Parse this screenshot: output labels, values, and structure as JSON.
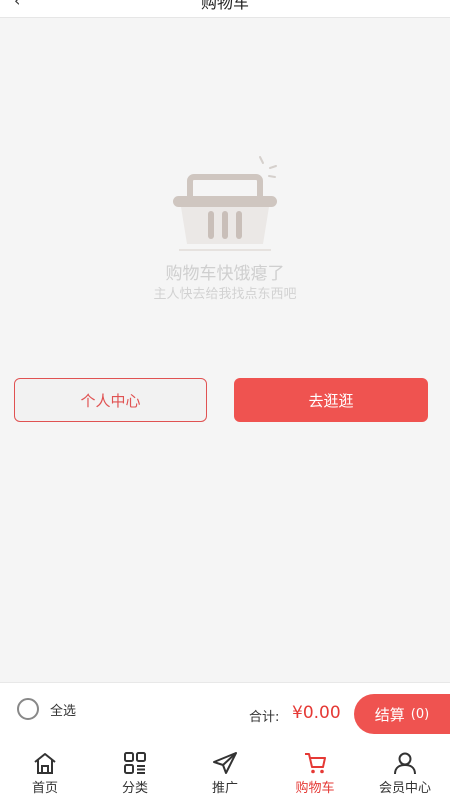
{
  "header": {
    "back_glyph": "‹",
    "title": "购物车"
  },
  "empty": {
    "icon": "empty-basket-icon",
    "title": "购物车快饿瘪了",
    "subtitle": "主人快去给我找点东西吧"
  },
  "actions": {
    "personal_center": "个人中心",
    "go_shopping": "去逛逛"
  },
  "footer": {
    "select_all": "全选",
    "total_label": "合计:",
    "total_value": "¥0.00",
    "checkout_label": "结算",
    "checkout_count": "(0)"
  },
  "tabs": [
    {
      "label": "首页",
      "icon": "home-icon",
      "active": false
    },
    {
      "label": "分类",
      "icon": "category-icon",
      "active": false
    },
    {
      "label": "推广",
      "icon": "send-icon",
      "active": false
    },
    {
      "label": "购物车",
      "icon": "cart-icon",
      "active": true
    },
    {
      "label": "会员中心",
      "icon": "user-icon",
      "active": false
    }
  ],
  "colors": {
    "accent": "#ef5350",
    "price": "#e53935",
    "background": "#f5f5f5"
  }
}
